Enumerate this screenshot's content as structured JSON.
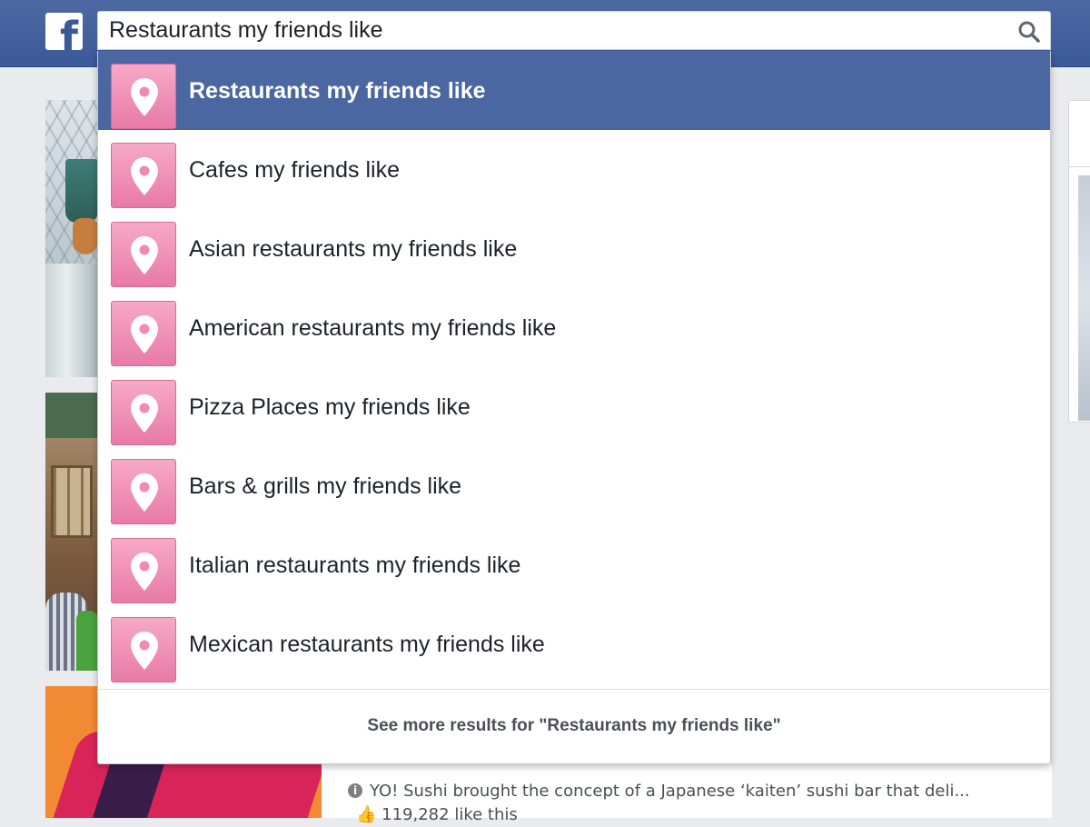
{
  "app": {
    "logo_letter": "f",
    "brand_color": "#3b5998"
  },
  "search": {
    "value": "Restaurants my friends like",
    "icon": "search-icon"
  },
  "suggestions": [
    {
      "label": "Restaurants my friends like",
      "icon": "map-pin-icon",
      "selected": true
    },
    {
      "label": "Cafes my friends like",
      "icon": "map-pin-icon",
      "selected": false
    },
    {
      "label": "Asian restaurants my friends like",
      "icon": "map-pin-icon",
      "selected": false
    },
    {
      "label": "American restaurants my friends like",
      "icon": "map-pin-icon",
      "selected": false
    },
    {
      "label": "Pizza Places my friends like",
      "icon": "map-pin-icon",
      "selected": false
    },
    {
      "label": "Bars & grills my friends like",
      "icon": "map-pin-icon",
      "selected": false
    },
    {
      "label": "Italian restaurants my friends like",
      "icon": "map-pin-icon",
      "selected": false
    },
    {
      "label": "Mexican restaurants my friends like",
      "icon": "map-pin-icon",
      "selected": false
    }
  ],
  "see_more": "See more results for \"Restaurants my friends like\"",
  "background": {
    "description_text": "YO! Sushi brought the concept of a Japanese ‘kaiten’ sushi bar that deli...",
    "likes_text": "119,282 like this"
  },
  "colors": {
    "selected_row": "#4b67a1",
    "pin_tile": "#f29bbf"
  }
}
